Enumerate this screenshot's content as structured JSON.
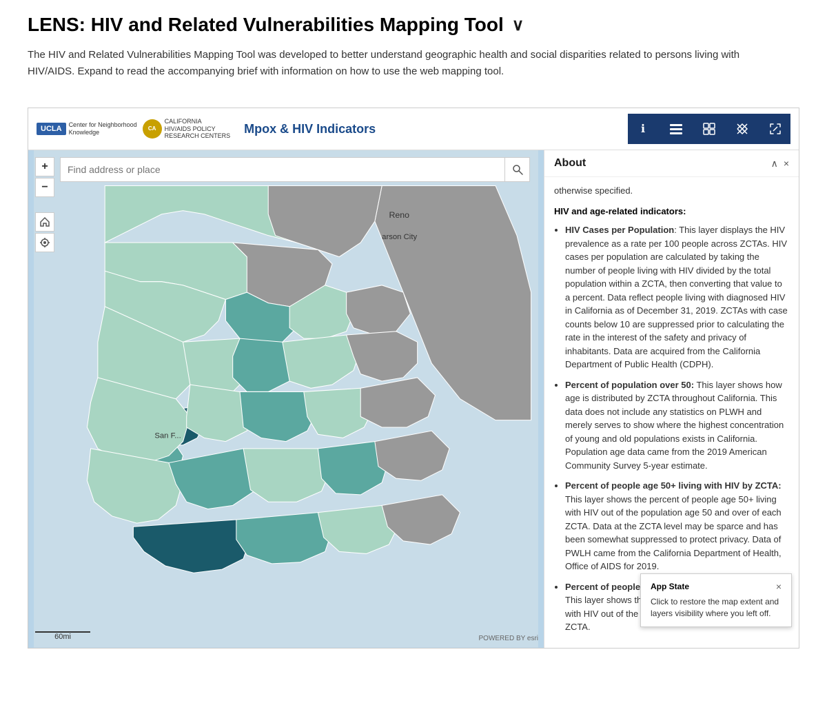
{
  "page": {
    "title": "LENS: HIV and Related Vulnerabilities Mapping Tool",
    "expand_icon": "∨",
    "description": "The HIV and Related Vulnerabilities Mapping Tool was developed to better understand geographic health and social disparities related to persons living with HIV/AIDS. Expand to read the accompanying brief with information on how to use the web mapping tool."
  },
  "map": {
    "title": "Mpox & HIV Indicators",
    "search_placeholder": "Find address or place",
    "zoom_in": "+",
    "zoom_out": "−",
    "city_labels": [
      "Reno",
      "arson City",
      "San F..."
    ],
    "scale_label": "60mi",
    "esri_text": "POWERED BY esri"
  },
  "toolbar": {
    "icons": [
      {
        "name": "info-icon",
        "symbol": "ℹ",
        "label": "Info"
      },
      {
        "name": "layers-icon",
        "symbol": "⧉",
        "label": "Layers"
      },
      {
        "name": "list-icon",
        "symbol": "≡",
        "label": "List"
      },
      {
        "name": "grid-icon",
        "symbol": "⊞",
        "label": "Grid"
      },
      {
        "name": "expand-icon",
        "symbol": "⤢",
        "label": "Expand"
      }
    ]
  },
  "about_panel": {
    "title": "About",
    "intro_text": "otherwise specified.",
    "section_title": "HIV and age-related indicators:",
    "items": [
      {
        "term": "HIV Cases per Population",
        "desc": ": This layer displays the HIV prevalence as a rate per 100 people across ZCTAs. HIV cases per population are calculated by taking the number of people living with HIV divided by the total population within a ZCTA, then converting that value to a percent. Data reflect people living with diagnosed HIV in California as of December 31, 2019. ZCTAs with case counts below 10 are suppressed prior to calculating the rate in the interest of the safety and privacy of inhabitants. Data are acquired from the California Department of Public Health (CDPH)."
      },
      {
        "term": "Percent of population over 50:",
        "desc": " This layer shows how age is distributed by ZCTA throughout California. This data does not include any statistics on PLWH and merely serves to show where the highest concentration of young and old populations exists in California. Population age data came from the 2019 American Community Survey 5-year estimate."
      },
      {
        "term": "Percent of people age 50+ living with HIV by ZCTA:",
        "desc": " This layer shows the percent of people age 50+ living with HIV out of the population age 50 and over of each ZCTA. Data at the ZCTA level may be sparce and has been somewhat suppressed to protect privacy. Data of PWLH came from the California Department of Health, Office of AIDS for 2019."
      },
      {
        "term": "Percent of people age 26-49 living with HIV by ZCTA:",
        "desc": " This layer shows the percent of people age 26-49 living with HIV out of the population age 50 and over of each ZCTA."
      }
    ]
  },
  "app_state": {
    "title": "App State",
    "text": "Click to restore the map extent and layers visibility where you left off.",
    "close": "×"
  },
  "logos": {
    "ucla_label": "UCLA",
    "cnk_line1": "Center for Neighborhood",
    "cnk_line2": "Knowledge",
    "caids_line1": "CALIFORNIA",
    "caids_line2": "HIV/AIDS POLICY",
    "caids_line3": "RESEARCH CENTERS"
  }
}
